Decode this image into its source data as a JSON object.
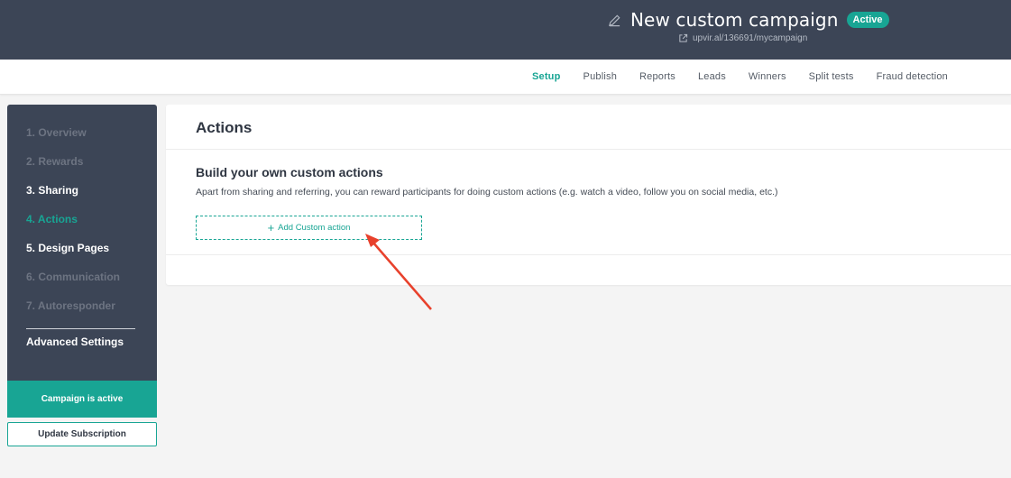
{
  "header": {
    "title": "New custom campaign",
    "status_badge": "Active",
    "url": "upvir.al/136691/mycampaign",
    "icons": {
      "edit": "pencil-icon",
      "link": "external-link-icon"
    }
  },
  "nav": {
    "tabs": [
      {
        "label": "Setup",
        "active": true
      },
      {
        "label": "Publish"
      },
      {
        "label": "Reports"
      },
      {
        "label": "Leads"
      },
      {
        "label": "Winners"
      },
      {
        "label": "Split tests"
      },
      {
        "label": "Fraud detection"
      }
    ]
  },
  "sidebar": {
    "items": [
      {
        "label": "1. Overview",
        "state": "dim"
      },
      {
        "label": "2. Rewards",
        "state": "dim"
      },
      {
        "label": "3. Sharing",
        "state": "on"
      },
      {
        "label": "4. Actions",
        "state": "active"
      },
      {
        "label": "5. Design Pages",
        "state": "on"
      },
      {
        "label": "6. Communication",
        "state": "dim"
      },
      {
        "label": "7. Autoresponder",
        "state": "dim"
      }
    ],
    "advanced": "Advanced Settings",
    "status_banner": "Campaign is active",
    "update_button": "Update Subscription"
  },
  "main": {
    "title": "Actions",
    "section_title": "Build your own custom actions",
    "section_desc": "Apart from sharing and referring, you can reward participants for doing custom actions (e.g. watch a video, follow you on social media, etc.)",
    "add_button": "Add Custom action",
    "add_icon": "plus-icon"
  },
  "colors": {
    "accent": "#18a594",
    "dark_bg": "#3c4556",
    "annotation_arrow": "#e8412c"
  }
}
